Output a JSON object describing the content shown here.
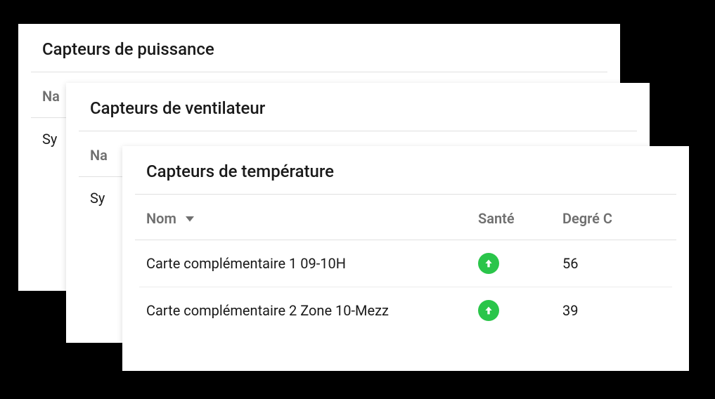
{
  "cards": {
    "power": {
      "title": "Capteurs de puissance",
      "header_name_partial": "Na",
      "row0_partial": "Sy"
    },
    "fan": {
      "title": "Capteurs de ventilateur",
      "header_name_partial": "Na",
      "row0_partial": "Sy"
    },
    "temperature": {
      "title": "Capteurs de température",
      "columns": {
        "name": "Nom",
        "health": "Santé",
        "degree": "Degré C"
      },
      "rows": [
        {
          "name": "Carte complémentaire 1 09-10H",
          "health": "ok",
          "degree": "56"
        },
        {
          "name": "Carte complémentaire 2 Zone 10-Mezz",
          "health": "ok",
          "degree": "39"
        }
      ]
    }
  },
  "colors": {
    "health_ok": "#2ac54a"
  }
}
